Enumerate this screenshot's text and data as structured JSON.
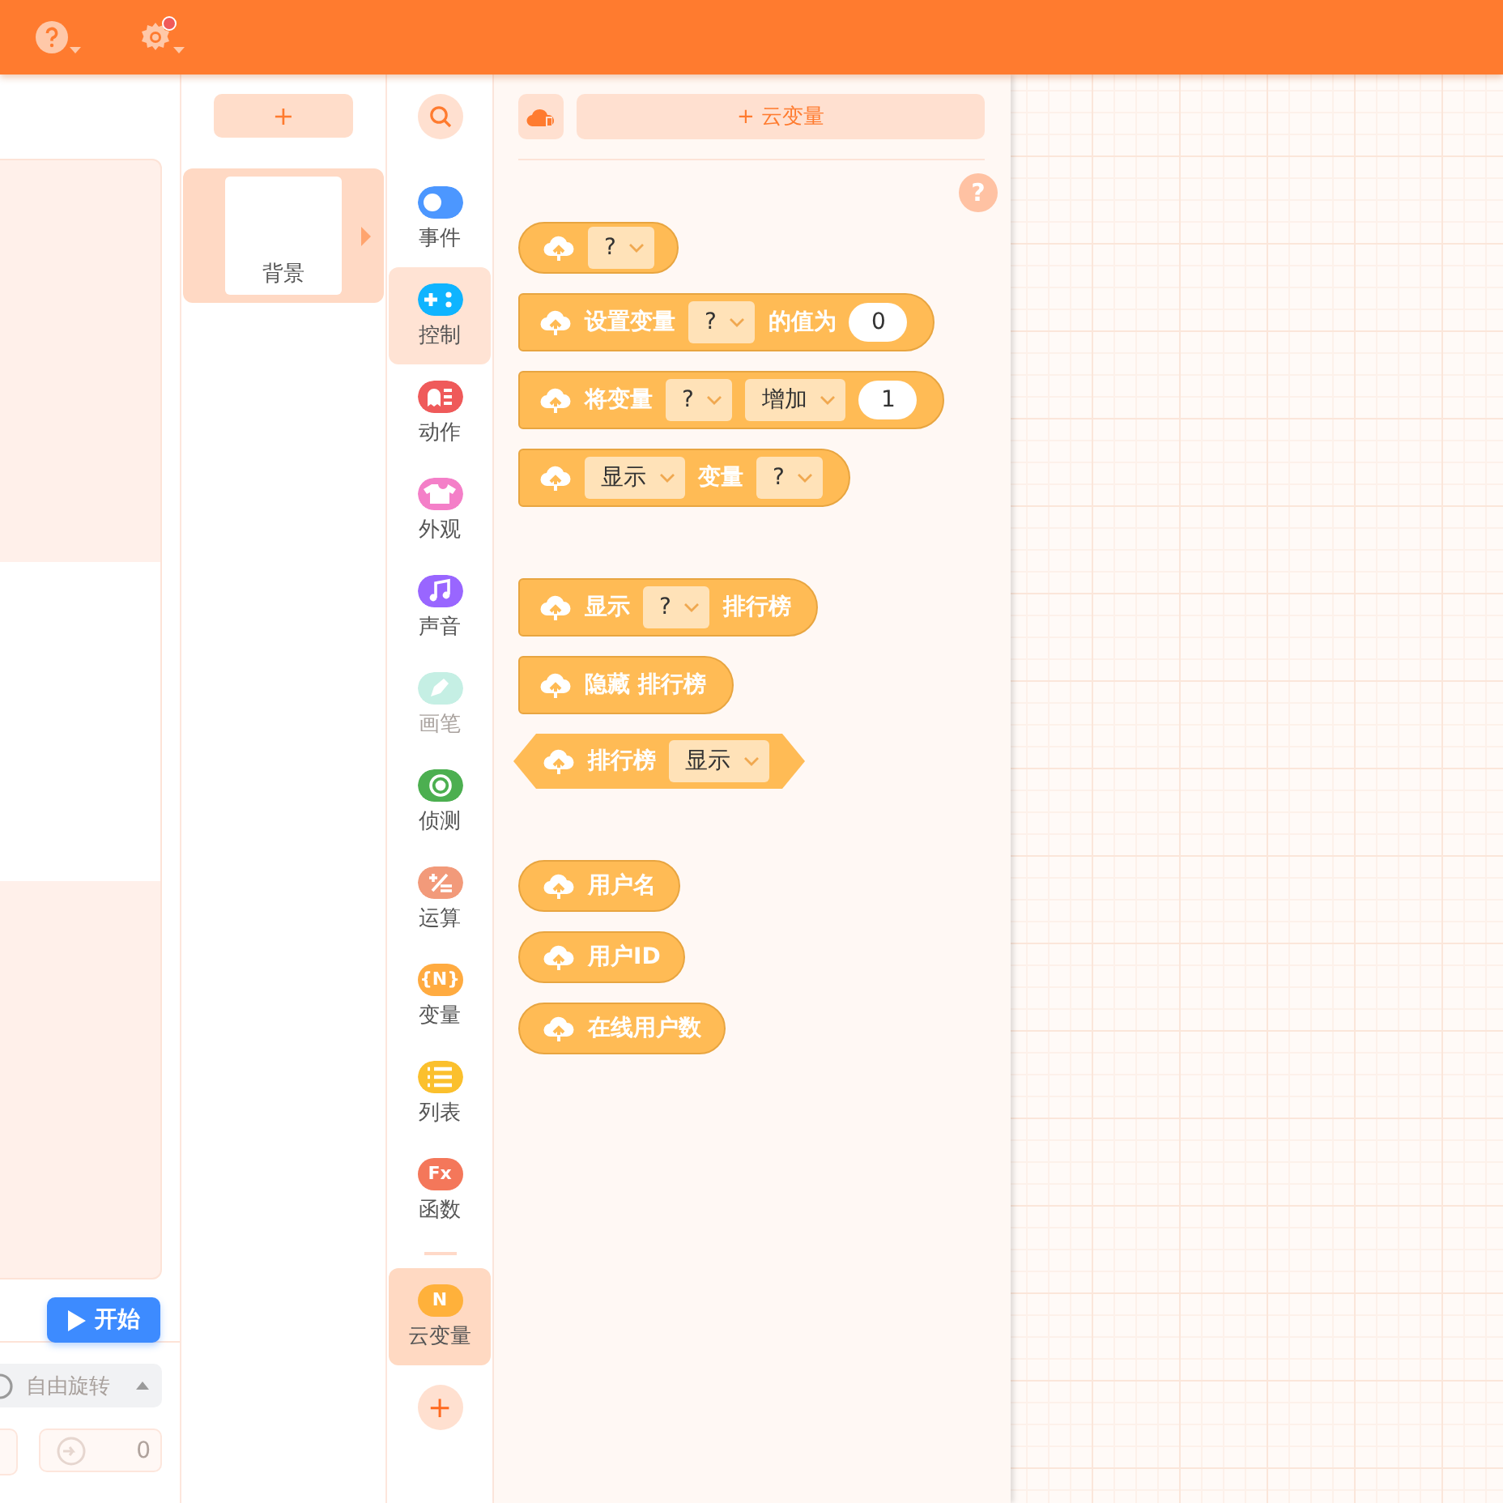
{
  "toolbar": {
    "settings_notification": true
  },
  "stage_panel": {
    "start_button": "开始",
    "rotation_mode": "自由旋转",
    "field_value": "0"
  },
  "sprites": {
    "add_button": "+",
    "items": [
      {
        "name": "背景",
        "selected": true
      }
    ]
  },
  "categories": {
    "items": [
      {
        "label": "事件",
        "color": "#4c97ff",
        "kind": "toggle",
        "selected": false,
        "disabled": false
      },
      {
        "label": "控制",
        "color": "#0fb4ff",
        "kind": "gamepad",
        "selected": true,
        "disabled": false
      },
      {
        "label": "动作",
        "color": "#ef5a5a",
        "kind": "ghost",
        "selected": false,
        "disabled": false
      },
      {
        "label": "外观",
        "color": "#f47fc8",
        "kind": "shirt",
        "selected": false,
        "disabled": false
      },
      {
        "label": "声音",
        "color": "#9966ff",
        "kind": "note",
        "selected": false,
        "disabled": false
      },
      {
        "label": "画笔",
        "color": "#c5efe4",
        "kind": "pen",
        "selected": false,
        "disabled": true
      },
      {
        "label": "侦测",
        "color": "#4caf50",
        "kind": "target",
        "selected": false,
        "disabled": false
      },
      {
        "label": "运算",
        "color": "#f29a7a",
        "kind": "math",
        "selected": false,
        "disabled": false
      },
      {
        "label": "变量",
        "color": "#ffab40",
        "kind": "text",
        "icon_text": "{N}",
        "selected": false,
        "disabled": false
      },
      {
        "label": "列表",
        "color": "#fbc02d",
        "kind": "list",
        "selected": false,
        "disabled": false
      },
      {
        "label": "函数",
        "color": "#f4775a",
        "kind": "text",
        "icon_text": "Fx",
        "selected": false,
        "disabled": false
      }
    ],
    "extras": [
      {
        "label": "云变量",
        "color": "#ffb13b",
        "kind": "cloud",
        "icon_text": "N",
        "selected": true,
        "disabled": false
      }
    ],
    "add_button": "+"
  },
  "palette": {
    "add_button": "+ 云变量",
    "help": "?",
    "block_groups": [
      [
        {
          "kind": "reporter",
          "parts": [
            {
              "kind": "dropdown",
              "text": "?"
            }
          ]
        },
        {
          "kind": "stack",
          "parts": [
            {
              "kind": "label",
              "text": "设置变量"
            },
            {
              "kind": "dropdown",
              "text": "?"
            },
            {
              "kind": "label",
              "text": "的值为"
            },
            {
              "kind": "input",
              "text": "0"
            }
          ]
        },
        {
          "kind": "stack",
          "parts": [
            {
              "kind": "label",
              "text": "将变量"
            },
            {
              "kind": "dropdown",
              "text": "?"
            },
            {
              "kind": "dropdown",
              "text": "增加"
            },
            {
              "kind": "input",
              "text": "1"
            }
          ]
        },
        {
          "kind": "stack",
          "parts": [
            {
              "kind": "dropdown",
              "text": "显示"
            },
            {
              "kind": "label",
              "text": "变量"
            },
            {
              "kind": "dropdown",
              "text": "?"
            }
          ]
        }
      ],
      [
        {
          "kind": "stack",
          "parts": [
            {
              "kind": "label",
              "text": "显示"
            },
            {
              "kind": "dropdown",
              "text": "?"
            },
            {
              "kind": "label",
              "text": "排行榜"
            }
          ]
        },
        {
          "kind": "stack",
          "parts": [
            {
              "kind": "label",
              "text": "隐藏 排行榜"
            }
          ]
        },
        {
          "kind": "boolean",
          "parts": [
            {
              "kind": "label",
              "text": "排行榜"
            },
            {
              "kind": "dropdown",
              "text": "显示"
            }
          ]
        }
      ],
      [
        {
          "kind": "reporter",
          "parts": [
            {
              "kind": "label",
              "text": "用户名"
            }
          ]
        },
        {
          "kind": "reporter",
          "parts": [
            {
              "kind": "label",
              "text": "用户ID"
            }
          ]
        },
        {
          "kind": "reporter",
          "parts": [
            {
              "kind": "label",
              "text": "在线用户数"
            }
          ]
        }
      ]
    ]
  }
}
